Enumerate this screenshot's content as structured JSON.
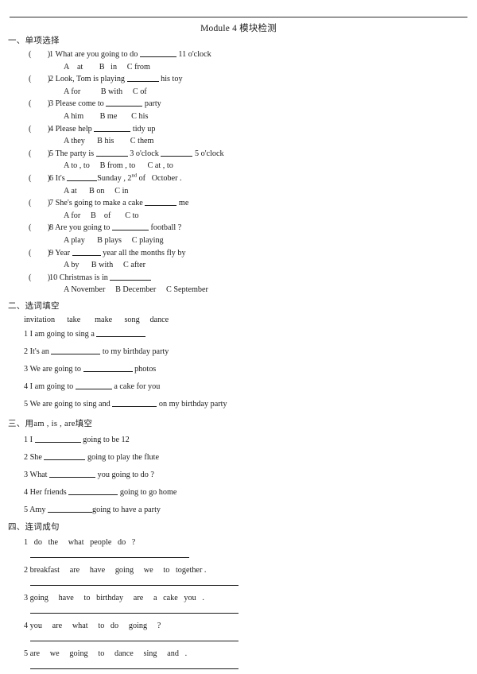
{
  "document": {
    "title": "Module 4  模块检测"
  },
  "sections": [
    {
      "heading_cn": "一、单项选择",
      "questions": [
        {
          "paren": "(        )",
          "stem_prefix": "1 What are you going to do ",
          "blank_width": 46,
          "stem_suffix": " 11 o'clock",
          "options": "A    at        B   in     C from"
        },
        {
          "paren": "(        )",
          "stem_prefix": "2 Look, Tom is playing ",
          "blank_width": 40,
          "stem_suffix": " his toy",
          "options": "A for          B with     C of"
        },
        {
          "paren": "(        )",
          "stem_prefix": "3 Please come to ",
          "blank_width": 46,
          "stem_suffix": " party",
          "options": "A him        B me       C his"
        },
        {
          "paren": "(        )",
          "stem_prefix": "4 Please help ",
          "blank_width": 46,
          "stem_suffix": " tidy up",
          "options": "A they      B his        C them"
        },
        {
          "paren": "(        )",
          "stem_prefix": "5 The party is ",
          "blank_width": 40,
          "stem_mid": " 3 o'clock ",
          "blank2_width": 40,
          "stem_suffix": " 5 o'clock",
          "options": "A to , to     B from , to      C at , to"
        },
        {
          "paren": "(        )",
          "stem_prefix": "6 It's ",
          "blank_width": 38,
          "stem_suffix": "Sunday , 2",
          "superscript": "nd",
          "stem_tail": " of   October .",
          "options": "A at      B on     C in"
        },
        {
          "paren": "(        )",
          "stem_prefix": "7 She's going to make a cake ",
          "blank_width": 40,
          "stem_suffix": " me",
          "options": "A for     B    of       C to"
        },
        {
          "paren": "(        )",
          "stem_prefix": "8 Are you going to ",
          "blank_width": 46,
          "stem_suffix": " football ?",
          "options": "A play      B plays     C playing"
        },
        {
          "paren": "(        )",
          "stem_prefix": "9 Year ",
          "blank_width": 36,
          "stem_suffix": " year all the months fly by",
          "options": "A by      B with     C after"
        },
        {
          "paren": "(        )",
          "stem_prefix": "10 Christmas is in ",
          "blank_width": 52,
          "stem_suffix": "",
          "options": "A November     B December     C September"
        }
      ]
    },
    {
      "heading_cn": "二、选词填空",
      "wordbank": "invitation      take       make      song     dance",
      "items": [
        {
          "prefix": "1 I am going to sing a ",
          "blank_width": 62,
          "suffix": ""
        },
        {
          "prefix": "2 It's an ",
          "blank_width": 62,
          "suffix": " to my birthday party"
        },
        {
          "prefix": "3 We are going to ",
          "blank_width": 62,
          "suffix": " photos"
        },
        {
          "prefix": "4 I am going to ",
          "blank_width": 46,
          "suffix": " a cake for you"
        },
        {
          "prefix": "5 We are going to sing and ",
          "blank_width": 56,
          "suffix": " on my birthday party"
        }
      ]
    },
    {
      "heading_cn_pre": "三、用",
      "heading_en": "am   ,   is    ,   are",
      "heading_cn_post": "填空",
      "items": [
        {
          "prefix": "1 I ",
          "blank_width": 58,
          "suffix": " going to be 12"
        },
        {
          "prefix": "2 She ",
          "blank_width": 52,
          "suffix": " going to play the flute"
        },
        {
          "prefix": "3 What ",
          "blank_width": 58,
          "suffix": " you going to do ?"
        },
        {
          "prefix": "4 Her friends ",
          "blank_width": 62,
          "suffix": " going to go home"
        },
        {
          "prefix": "5 Amy ",
          "blank_width": 56,
          "suffix": "going to have a party"
        }
      ]
    },
    {
      "heading_cn": "四、连词成句",
      "items": [
        {
          "words": "1   do   the     what   people   do   ?",
          "rule_width": 200
        },
        {
          "words": "2 breakfast     are     have     going     we     to   together .",
          "rule_width": 262
        },
        {
          "words": "3 going     have     to   birthday     are     a   cake   you   .",
          "rule_width": 262
        },
        {
          "words": "4 you     are     what     to   do     going     ?",
          "rule_width": 262
        },
        {
          "words": "5 are     we     going     to     dance     sing     and   .",
          "rule_width": 262
        }
      ]
    }
  ]
}
